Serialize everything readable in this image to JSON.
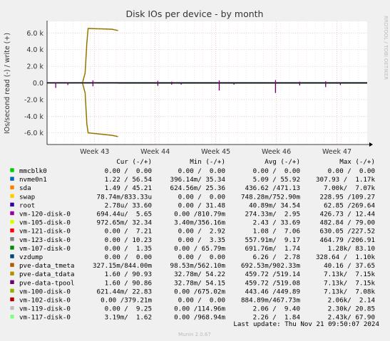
{
  "chart_data": {
    "type": "line",
    "title": "Disk IOs per device - by month",
    "ylabel": "IOs/second read (-) / write (+)",
    "side_label": "RRDTOOL / TOBI OETIKER",
    "ylim": [
      -7.4,
      7.4
    ],
    "y_ticks": [
      {
        "v": 6,
        "label": "6.0 k"
      },
      {
        "v": 4,
        "label": "4.0 k"
      },
      {
        "v": 2,
        "label": "2.0 k"
      },
      {
        "v": 0,
        "label": "0.0"
      },
      {
        "v": -2,
        "label": "-2.0 k"
      },
      {
        "v": -4,
        "label": "-4.0 k"
      },
      {
        "v": -6,
        "label": "-6.0 k"
      }
    ],
    "xlim": [
      0,
      37
    ],
    "x_ticks": [
      {
        "v": 5.5,
        "label": "Week 43"
      },
      {
        "v": 12.5,
        "label": "Week 44"
      },
      {
        "v": 19.5,
        "label": "Week 45"
      },
      {
        "v": 26.5,
        "label": "Week 46"
      },
      {
        "v": 33.5,
        "label": "Week 47"
      }
    ],
    "spikes": {
      "write": [
        [
          5.3,
          0.3
        ],
        [
          12.8,
          0.25
        ],
        [
          14.4,
          0.15
        ],
        [
          19.9,
          0.3
        ],
        [
          26.4,
          0.35
        ],
        [
          29.2,
          0.15
        ],
        [
          32.2,
          0.2
        ]
      ],
      "read": [
        [
          1.0,
          -0.6
        ],
        [
          2.4,
          -0.25
        ],
        [
          5.3,
          -0.4
        ],
        [
          12.8,
          -0.35
        ],
        [
          14.4,
          -0.2
        ],
        [
          15.5,
          -0.2
        ],
        [
          19.9,
          -0.9
        ],
        [
          21.6,
          -0.2
        ],
        [
          26.4,
          -1.2
        ],
        [
          29.2,
          -0.3
        ],
        [
          32.2,
          -0.5
        ],
        [
          33.9,
          -0.25
        ]
      ]
    },
    "swap_events": {
      "write": [
        [
          4.1,
          0.05
        ],
        [
          4.4,
          1.2
        ],
        [
          4.6,
          4.8
        ],
        [
          4.75,
          6.55
        ],
        [
          7.5,
          6.45
        ],
        [
          8.2,
          6.3
        ]
      ],
      "read": [
        [
          4.1,
          -0.05
        ],
        [
          4.4,
          -1.2
        ],
        [
          4.6,
          -4.9
        ],
        [
          4.75,
          -6.0
        ],
        [
          7.5,
          -6.3
        ],
        [
          8.2,
          -6.45
        ]
      ]
    },
    "legend_header": {
      "cur": "Cur (-/+)",
      "min": "Min (-/+)",
      "avg": "Avg (-/+)",
      "max": "Max (-/+)"
    },
    "series": [
      {
        "name": "mmcblk0",
        "color": "#00cc00",
        "cur": "0.00 /  0.00",
        "min": "0.00 /  0.00",
        "avg": "0.00 /  0.00",
        "max": "0.00 /  0.00"
      },
      {
        "name": "nvme0n1",
        "color": "#0066b3",
        "cur": "1.22 / 56.54",
        "min": "396.14m/ 35.34",
        "avg": "5.09 / 55.92",
        "max": "307.93 /  1.17k"
      },
      {
        "name": "sda",
        "color": "#ff8000",
        "cur": "1.49 / 45.21",
        "min": "624.56m/ 25.36",
        "avg": "436.62 /471.13",
        "max": "7.00k/  7.07k"
      },
      {
        "name": "swap",
        "color": "#ffcc00",
        "cur": "78.74m/833.33u",
        "min": "0.00 /  0.00",
        "avg": "748.28m/752.90m",
        "max": "228.95 /109.27"
      },
      {
        "name": "root",
        "color": "#330099",
        "cur": "2.78u/ 33.60",
        "min": "0.00 / 31.48",
        "avg": "40.89m/ 34.54",
        "max": "62.85 /269.64"
      },
      {
        "name": "vm-120-disk-0",
        "color": "#990099",
        "cur": "694.44u/  5.65",
        "min": "0.00 /810.79m",
        "avg": "274.33m/  2.95",
        "max": "426.73 / 12.44"
      },
      {
        "name": "vm-105-disk-0",
        "color": "#ccff00",
        "cur": "972.65m/ 32.34",
        "min": "3.40m/356.16m",
        "avg": "2.43 / 33.69",
        "max": "482.84 / 79.00"
      },
      {
        "name": "vm-121-disk-0",
        "color": "#ff0000",
        "cur": "0.00 /  7.21",
        "min": "0.00 /  2.92",
        "avg": "1.08 /  7.06",
        "max": "630.05 /227.52"
      },
      {
        "name": "vm-123-disk-0",
        "color": "#808080",
        "cur": "0.00 / 10.23",
        "min": "0.00 /  3.35",
        "avg": "557.91m/  9.17",
        "max": "464.79 /206.91"
      },
      {
        "name": "vm-107-disk-0",
        "color": "#008f00",
        "cur": "0.00 /  1.35",
        "min": "0.00 / 65.79m",
        "avg": "691.76m/  1.74",
        "max": "1.28k/ 83.10"
      },
      {
        "name": "vzdump",
        "color": "#00487d",
        "cur": "0.00 /  0.00",
        "min": "0.00 /  0.00",
        "avg": "6.26 /  2.78",
        "max": "328.64 /  1.10k"
      },
      {
        "name": "pve-data_tmeta",
        "color": "#b35a00",
        "cur": "327.15m/844.00m",
        "min": "98.53m/562.10m",
        "avg": "692.53m/902.33m",
        "max": "40.16 / 37.65"
      },
      {
        "name": "pve-data_tdata",
        "color": "#b38f00",
        "cur": "1.60 / 90.93",
        "min": "32.78m/ 54.22",
        "avg": "459.72 /519.14",
        "max": "7.13k/  7.15k"
      },
      {
        "name": "pve-data-tpool",
        "color": "#6b006b",
        "cur": "1.60 / 90.86",
        "min": "32.78m/ 54.15",
        "avg": "459.72 /519.08",
        "max": "7.13k/  7.15k"
      },
      {
        "name": "vm-100-disk-0",
        "color": "#8fb300",
        "cur": "621.44m/ 22.83",
        "min": "0.00 /675.02m",
        "avg": "443.46 /449.89",
        "max": "7.13k/  7.08k"
      },
      {
        "name": "vm-102-disk-0",
        "color": "#b30000",
        "cur": "0.00 /379.21m",
        "min": "0.00 /  0.00",
        "avg": "884.89m/467.73m",
        "max": "2.06k/  2.14"
      },
      {
        "name": "vm-119-disk-0",
        "color": "#bebebe",
        "cur": "0.00 /  9.25",
        "min": "0.00 /114.96m",
        "avg": "2.06 /  9.40",
        "max": "2.30k/ 20.85"
      },
      {
        "name": "vm-117-disk-0",
        "color": "#80ff80",
        "cur": "3.19m/  1.62",
        "min": "0.00 /968.94m",
        "avg": "2.26 /  1.84",
        "max": "2.43k/ 67.90"
      }
    ],
    "last_update": "Last update: Thu Nov 21 09:50:07 2024",
    "footer": "Munin 2.0.67"
  }
}
